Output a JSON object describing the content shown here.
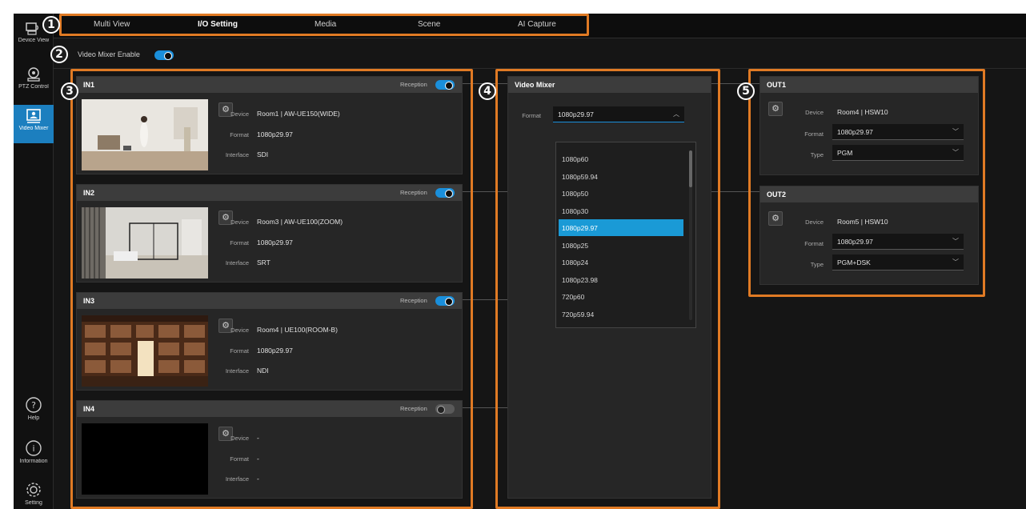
{
  "sidebar": {
    "items": [
      {
        "label": "Device View",
        "icon": "device-view-icon"
      },
      {
        "label": "PTZ Control",
        "icon": "ptz-camera-icon"
      },
      {
        "label": "Video Mixer",
        "icon": "video-mixer-icon",
        "active": true
      }
    ],
    "bottom": [
      {
        "label": "Help",
        "icon": "help-icon"
      },
      {
        "label": "Information",
        "icon": "info-icon"
      },
      {
        "label": "Setting",
        "icon": "gear-icon"
      }
    ]
  },
  "tabs": [
    {
      "label": "Multi View"
    },
    {
      "label": "I/O Setting",
      "active": true
    },
    {
      "label": "Media"
    },
    {
      "label": "Scene"
    },
    {
      "label": "AI Capture"
    }
  ],
  "enable": {
    "label": "Video Mixer Enable",
    "on": true
  },
  "labels": {
    "reception": "Reception",
    "device": "Device",
    "format": "Format",
    "interface": "Interface",
    "type": "Type"
  },
  "inputs": [
    {
      "title": "IN1",
      "reception": true,
      "device": "Room1 | AW-UE150(WIDE)",
      "format": "1080p29.97",
      "interface": "SDI"
    },
    {
      "title": "IN2",
      "reception": true,
      "device": "Room3 | AW-UE100(ZOOM)",
      "format": "1080p29.97",
      "interface": "SRT"
    },
    {
      "title": "IN3",
      "reception": true,
      "device": "Room4 | UE100(ROOM-B)",
      "format": "1080p29.97",
      "interface": "NDI"
    },
    {
      "title": "IN4",
      "reception": false,
      "device": "-",
      "format": "-",
      "interface": "-"
    }
  ],
  "mixer": {
    "title": "Video Mixer",
    "format_label": "Format",
    "format_value": "1080p29.97",
    "options": [
      "1080p60",
      "1080p59.94",
      "1080p50",
      "1080p30",
      "1080p29.97",
      "1080p25",
      "1080p24",
      "1080p23.98",
      "720p60",
      "720p59.94"
    ],
    "selected": "1080p29.97"
  },
  "outputs": [
    {
      "title": "OUT1",
      "device": "Room4 | HSW10",
      "format": "1080p29.97",
      "type": "PGM"
    },
    {
      "title": "OUT2",
      "device": "Room5 | HSW10",
      "format": "1080p29.97",
      "type": "PGM+DSK"
    }
  ],
  "callouts": [
    "1",
    "2",
    "3",
    "4",
    "5"
  ],
  "colors": {
    "accent": "#1a8fdb",
    "highlight": "#e07a24",
    "selected": "#1a9ad6"
  }
}
